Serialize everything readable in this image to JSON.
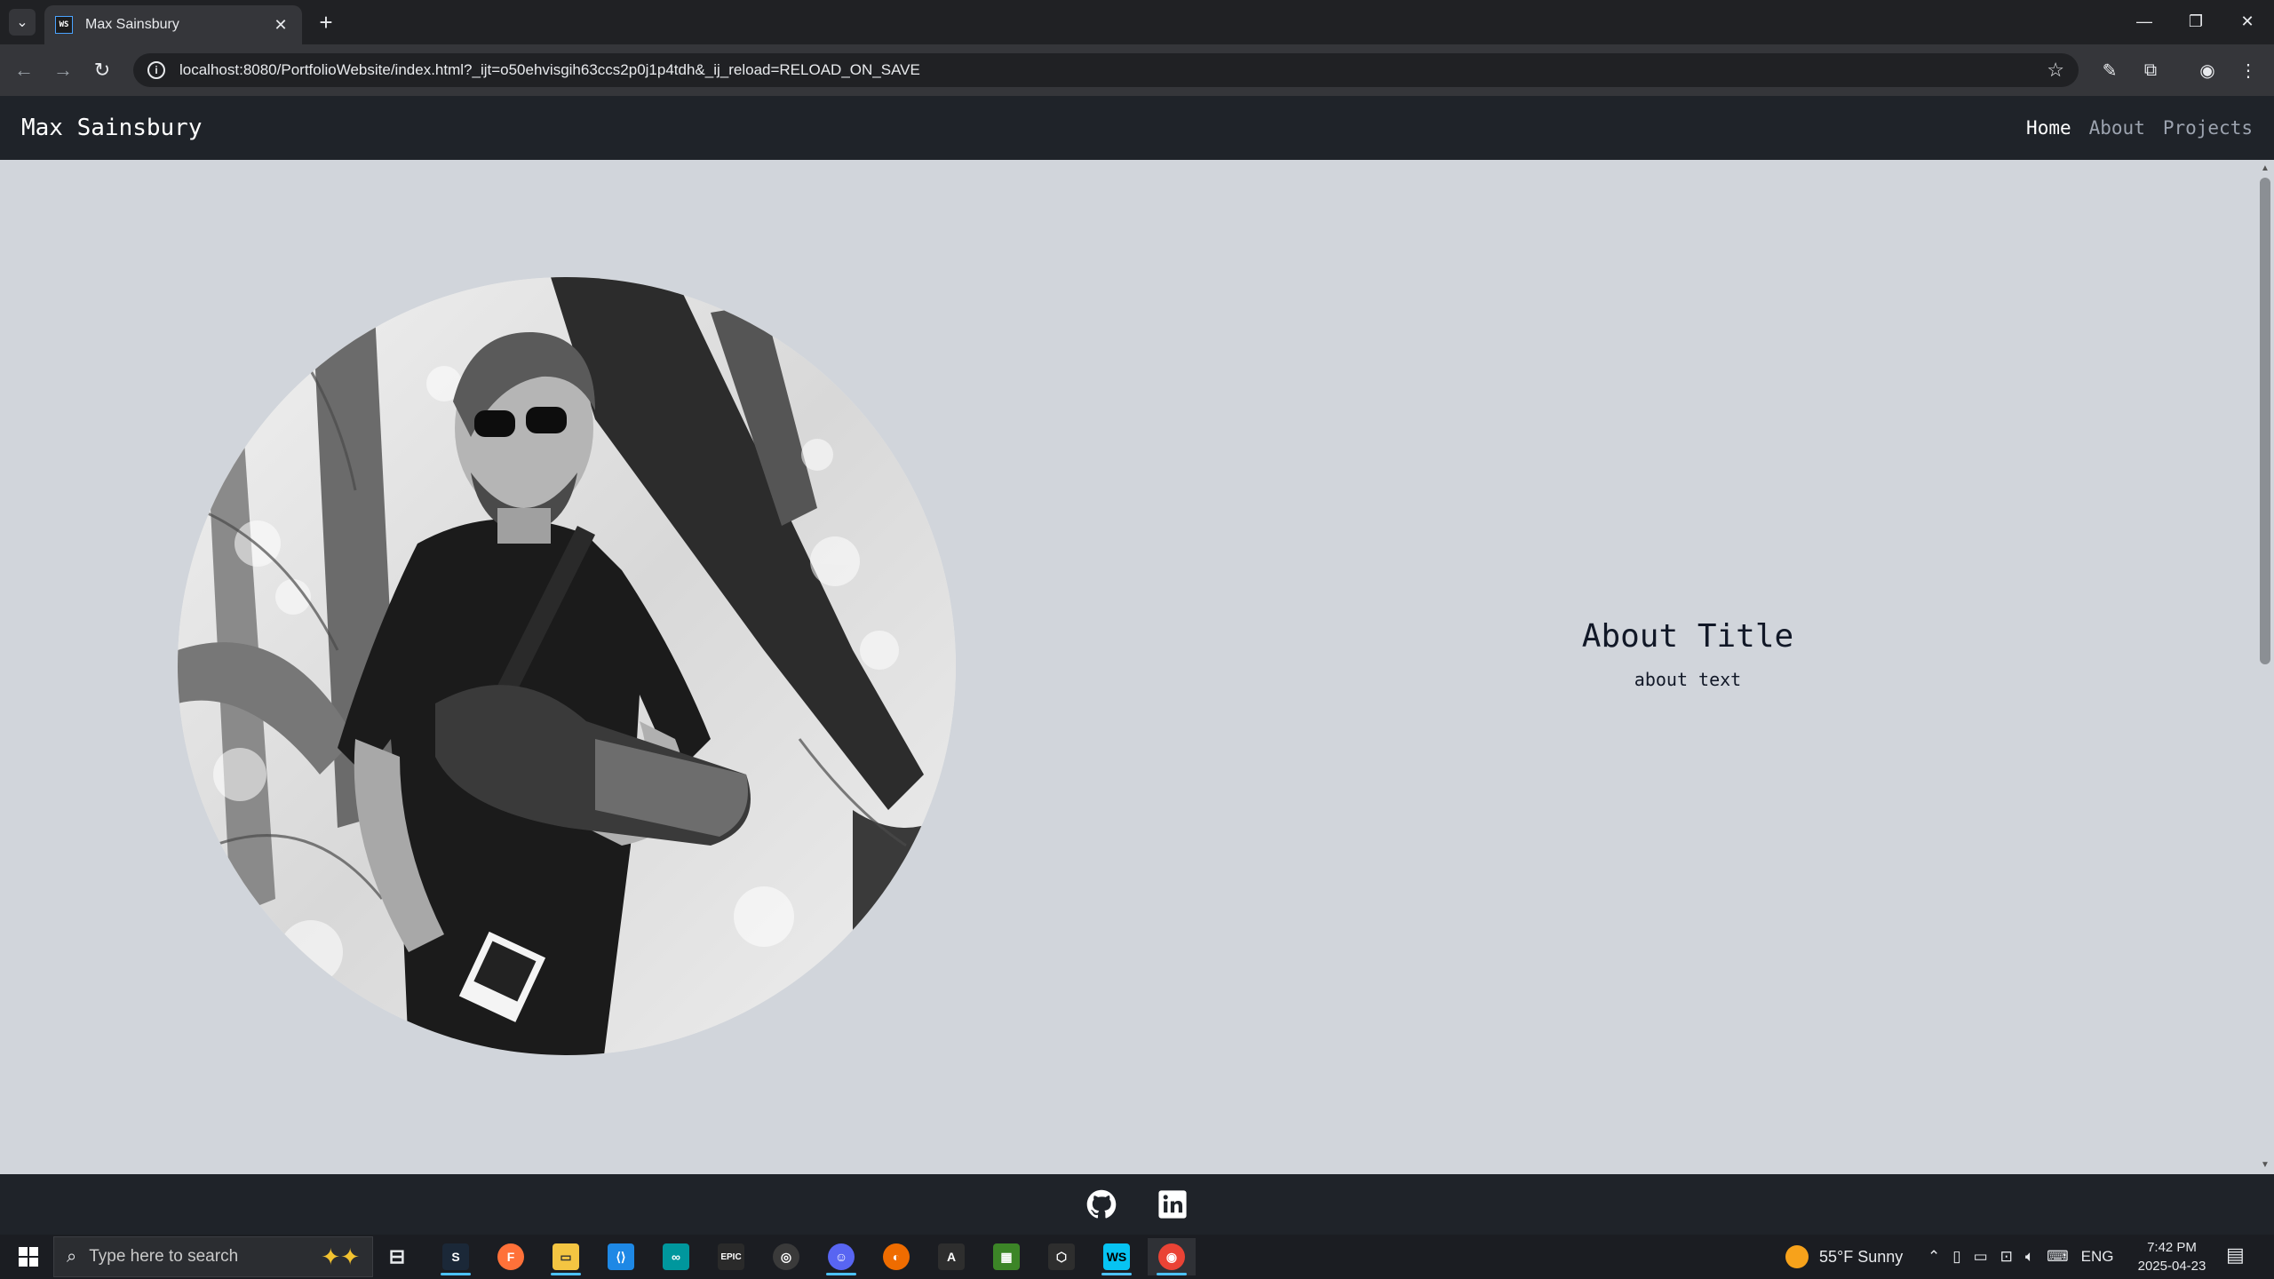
{
  "browser": {
    "tab_title": "Max Sainsbury",
    "tab_favicon": "WS",
    "url": "localhost:8080/PortfolioWebsite/index.html?_ijt=o50ehvisgih63ccs2p0j1p4tdh&_ij_reload=RELOAD_ON_SAVE"
  },
  "site": {
    "brand": "Max Sainsbury",
    "nav": [
      {
        "label": "Home"
      },
      {
        "label": "About"
      },
      {
        "label": "Projects"
      }
    ],
    "about_title": "About Title",
    "about_text": "about text",
    "colors": {
      "page_bg": "#d1d5db",
      "nav_bg": "#1f2329",
      "nav_active": "#ffffff",
      "nav_inactive": "#9ca3af"
    },
    "footer_icons": [
      "github-icon",
      "linkedin-icon"
    ]
  },
  "taskbar": {
    "search_placeholder": "Type here to search",
    "weather": "55°F  Sunny",
    "language": "ENG",
    "time": "7:42 PM",
    "date": "2025-04-23",
    "apps": [
      "task-view",
      "steam",
      "firefox",
      "file-explorer",
      "vscode",
      "arduino",
      "epic-games",
      "blender",
      "discord",
      "unity-hub",
      "inkscape",
      "minecraft",
      "unity",
      "webstorm",
      "chrome"
    ]
  }
}
